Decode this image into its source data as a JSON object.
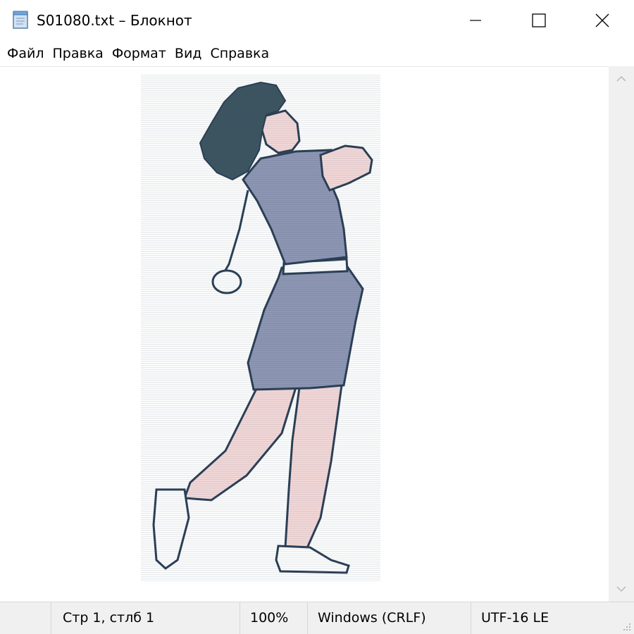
{
  "window": {
    "title": "S01080.txt – Блокнот",
    "controls": {
      "minimize": "minimize",
      "maximize": "maximize",
      "close": "close"
    }
  },
  "menu": {
    "items": [
      "Файл",
      "Правка",
      "Формат",
      "Вид",
      "Справка"
    ]
  },
  "editor": {
    "content_description_icon": "ascii-art-golfer"
  },
  "status": {
    "position": "Стр 1, стлб 1",
    "zoom": "100%",
    "line_endings": "Windows (CRLF)",
    "encoding": "UTF-16 LE"
  },
  "colors": {
    "outline": "#2b3f55",
    "shirt": "#8f98b5",
    "skin": "#f6dada",
    "hair": "#3c5560"
  }
}
